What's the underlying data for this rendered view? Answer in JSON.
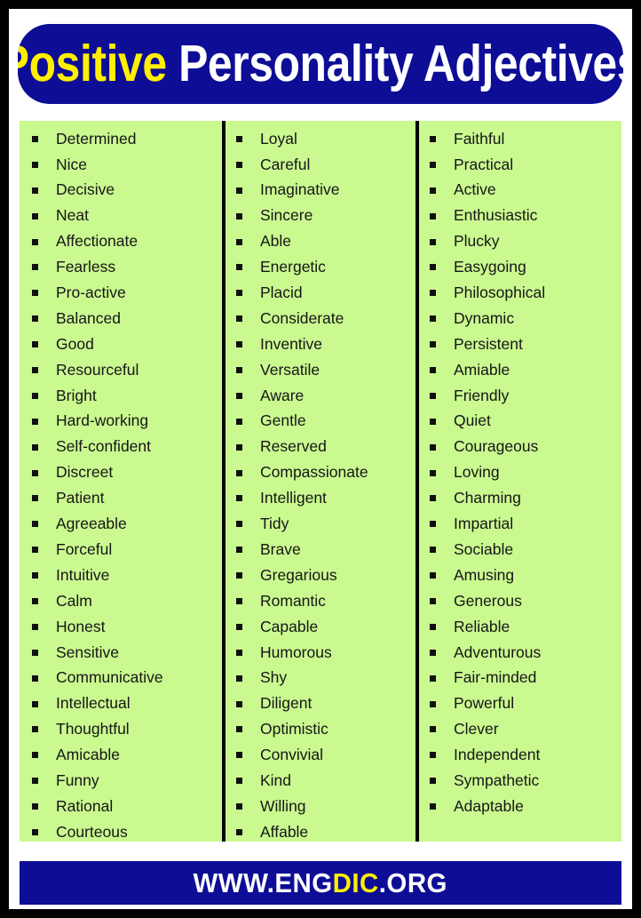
{
  "title": {
    "accent_word": "Positive",
    "rest": " Personality Adjectives",
    "accent_color": "#FFEF00",
    "text_color": "#FFFFFF",
    "background_color": "#0D0D96"
  },
  "panel": {
    "background_color": "#CAF990",
    "bullet_color": "#101010",
    "text_color": "#161616"
  },
  "columns": [
    {
      "id": "column-1",
      "items": [
        "Determined",
        "Nice",
        "Decisive",
        "Neat",
        "Affectionate",
        "Fearless",
        "Pro-active",
        "Balanced",
        "Good",
        "Resourceful",
        "Bright",
        "Hard-working",
        "Self-confident",
        "Discreet",
        "Patient",
        "Agreeable",
        "Forceful",
        "Intuitive",
        "Calm",
        "Honest",
        "Sensitive",
        "Communicative",
        "Intellectual",
        "Thoughtful",
        "Amicable",
        "Funny",
        "Rational",
        "Courteous"
      ]
    },
    {
      "id": "column-2",
      "items": [
        "Loyal",
        "Careful",
        "Imaginative",
        "Sincere",
        "Able",
        "Energetic",
        "Placid",
        "Considerate",
        "Inventive",
        "Versatile",
        "Aware",
        "Gentle",
        "Reserved",
        "Compassionate",
        "Intelligent",
        "Tidy",
        "Brave",
        "Gregarious",
        "Romantic",
        "Capable",
        "Humorous",
        "Shy",
        "Diligent",
        "Optimistic",
        "Convivial",
        "Kind",
        "Willing",
        "Affable"
      ]
    },
    {
      "id": "column-3",
      "items": [
        "Faithful",
        "Practical",
        "Active",
        "Enthusiastic",
        "Plucky",
        "Easygoing",
        "Philosophical",
        "Dynamic",
        "Persistent",
        "Amiable",
        "Friendly",
        "Quiet",
        "Courageous",
        "Loving",
        "Charming",
        "Impartial",
        "Sociable",
        "Amusing",
        "Generous",
        "Reliable",
        "Adventurous",
        "Fair-minded",
        "Powerful",
        "Clever",
        "Independent",
        "Sympathetic",
        "Adaptable"
      ]
    }
  ],
  "footer": {
    "prefix": "WWW.ENG",
    "accent": "DIC",
    "suffix": ".ORG",
    "accent_color": "#FFEF00",
    "text_color": "#FFFFFF",
    "background_color": "#0D0D96"
  }
}
